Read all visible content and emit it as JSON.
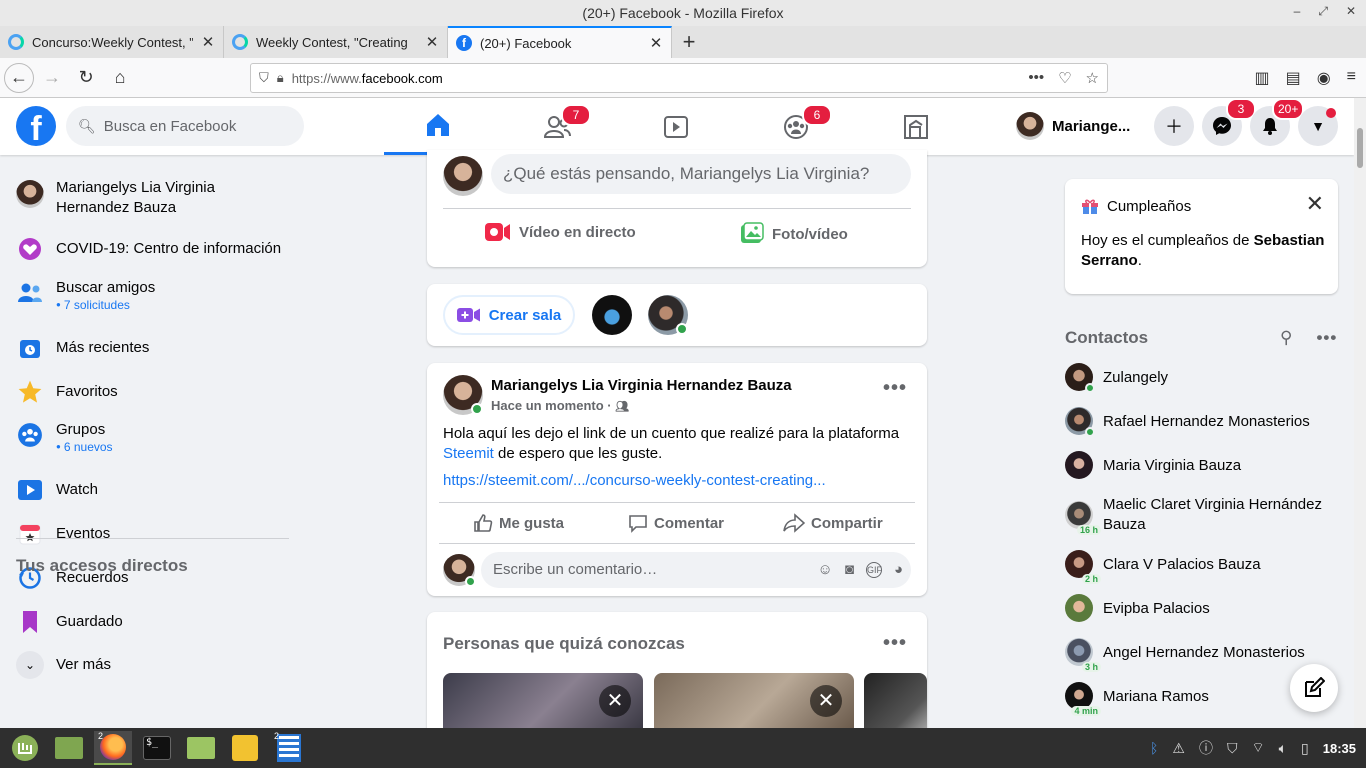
{
  "window": {
    "title": "(20+) Facebook - Mozilla Firefox"
  },
  "tabs": [
    {
      "label": "Concurso:Weekly Contest, \"",
      "icon": "steemit-icon"
    },
    {
      "label": "Weekly Contest, \"Creating",
      "icon": "steemit-icon"
    },
    {
      "label": "(20+) Facebook",
      "icon": "facebook-icon"
    }
  ],
  "url": {
    "scheme": "https://www.",
    "host": "facebook.com"
  },
  "fb": {
    "search_placeholder": "Busca en Facebook",
    "badges": {
      "friends": "7",
      "groups": "6",
      "messenger": "3",
      "notifications": "20+"
    },
    "profile_name": "Mariange...",
    "brand_color": "#1877f2"
  },
  "sidebar": {
    "profile": "Mariangelys Lia Virginia Hernandez Bauza",
    "items": [
      {
        "label": "COVID-19: Centro de información",
        "sub": ""
      },
      {
        "label": "Buscar amigos",
        "sub": "7 solicitudes"
      },
      {
        "label": "Más recientes",
        "sub": ""
      },
      {
        "label": "Favoritos",
        "sub": ""
      },
      {
        "label": "Grupos",
        "sub": "6 nuevos"
      },
      {
        "label": "Watch",
        "sub": ""
      },
      {
        "label": "Eventos",
        "sub": ""
      },
      {
        "label": "Recuerdos",
        "sub": ""
      },
      {
        "label": "Guardado",
        "sub": ""
      },
      {
        "label": "Ver más",
        "sub": ""
      }
    ],
    "shortcuts_title": "Tus accesos directos"
  },
  "composer": {
    "placeholder": "¿Qué estás pensando, Mariangelys Lia Virginia?",
    "live": "Vídeo en directo",
    "photo": "Foto/vídeo"
  },
  "rooms": {
    "create": "Crear sala"
  },
  "post": {
    "author": "Mariangelys Lia Virginia Hernandez Bauza",
    "time": "Hace un momento ·",
    "text_before": "Hola aquí les dejo el link de un cuento que realizé para la plataforma ",
    "text_link": "Steemit",
    "text_after": " de espero que les guste.",
    "link": "https://steemit.com/.../concurso-weekly-contest-creating...",
    "like": "Me gusta",
    "comment": "Comentar",
    "share": "Compartir",
    "comment_placeholder": "Escribe un comentario…"
  },
  "pymk": {
    "title": "Personas que quizá conozcas"
  },
  "birthday": {
    "title": "Cumpleaños",
    "text": "Hoy es el cumpleaños de ",
    "name": "Sebastian Serrano",
    "suffix": "."
  },
  "contacts": {
    "title": "Contactos",
    "list": [
      {
        "name": "Zulangely",
        "status": "online",
        "time": ""
      },
      {
        "name": "Rafael Hernandez Monasterios",
        "status": "online",
        "time": ""
      },
      {
        "name": "Maria Virginia Bauza",
        "status": "none",
        "time": ""
      },
      {
        "name": "Maelic Claret Virginia Hernández Bauza",
        "status": "away",
        "time": "16 h"
      },
      {
        "name": "Clara V Palacios Bauza",
        "status": "away",
        "time": "2 h"
      },
      {
        "name": "Evipba Palacios",
        "status": "none",
        "time": ""
      },
      {
        "name": "Angel Hernandez Monasterios",
        "status": "away",
        "time": "3 h"
      },
      {
        "name": "Mariana Ramos",
        "status": "away",
        "time": "4 min"
      }
    ]
  },
  "taskbar": {
    "clock": "18:35",
    "firefox_count": "2",
    "writer_count": "2"
  }
}
